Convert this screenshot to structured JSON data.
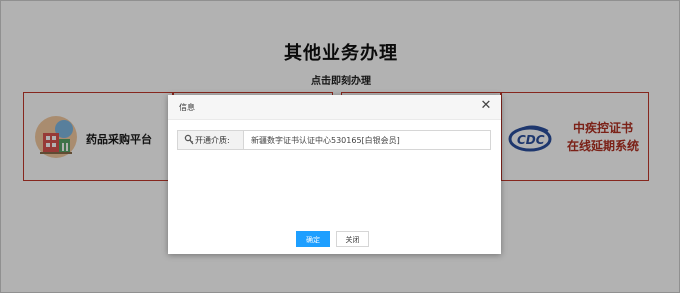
{
  "page": {
    "title": "其他业务办理",
    "subtitle": "点击即刻办理"
  },
  "cards": {
    "pharma": {
      "label": "药品采购平台",
      "icon": "pharma-building-icon"
    },
    "cdc": {
      "line1": "中疾控证书",
      "line2": "在线延期系统",
      "icon": "cdc-logo"
    }
  },
  "dialog": {
    "title": "信息",
    "close_icon": "close-icon",
    "field_label": "开通介质:",
    "field_icon": "key-icon",
    "field_value": "新疆数字证书认证中心530165[白银会员]",
    "ok_label": "确定",
    "close_label": "关闭"
  },
  "colors": {
    "card_border": "#c0392b",
    "cdc_text": "#b03022",
    "primary_button": "#1e9fff",
    "overlay": "rgba(0,0,0,0.30)"
  }
}
